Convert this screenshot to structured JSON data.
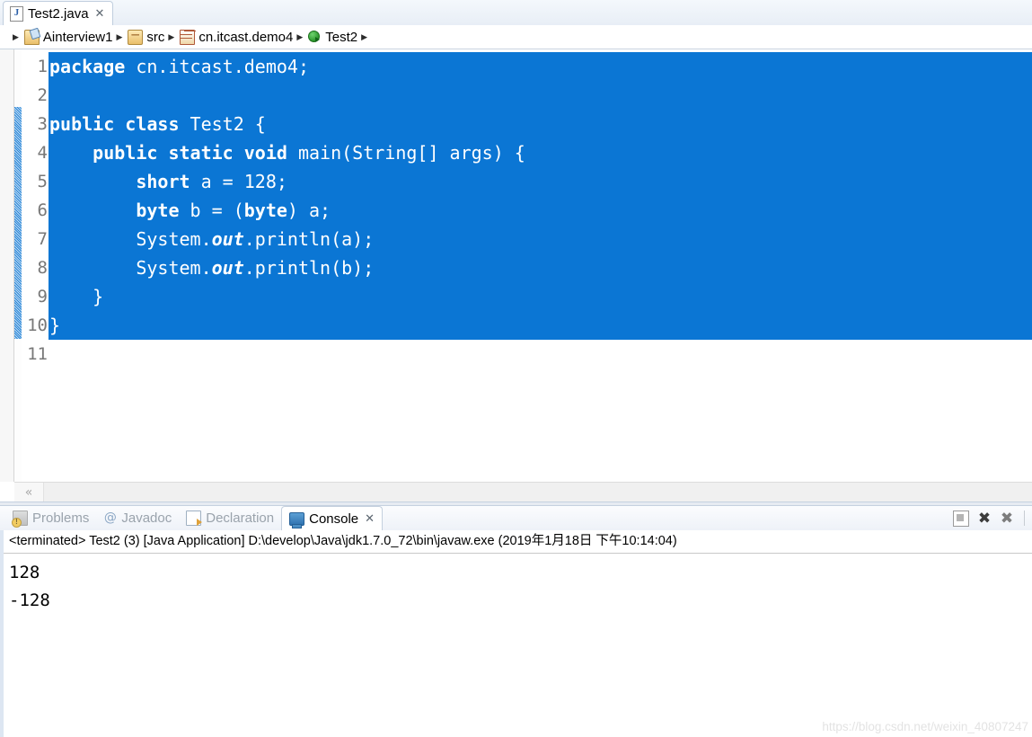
{
  "editor": {
    "tab": {
      "file_icon": "java-file-icon",
      "label": "Test2.java",
      "close": "✕"
    },
    "breadcrumb": {
      "separator": "▶",
      "items": [
        {
          "icon": "project-icon",
          "label": "Ainterview1"
        },
        {
          "icon": "source-folder-icon",
          "label": "src"
        },
        {
          "icon": "package-icon",
          "label": "cn.itcast.demo4"
        },
        {
          "icon": "java-class-icon",
          "label": "Test2"
        }
      ]
    },
    "line_numbers": [
      "1",
      "2",
      "3",
      "4",
      "5",
      "6",
      "7",
      "8",
      "9",
      "10",
      "11"
    ],
    "code_lines": [
      {
        "selected": true,
        "tokens": [
          {
            "t": "kw",
            "v": "package"
          },
          {
            "t": "pl",
            "v": " cn.itcast.demo4;"
          }
        ]
      },
      {
        "selected": true,
        "tokens": [
          {
            "t": "pl",
            "v": ""
          }
        ]
      },
      {
        "selected": true,
        "tokens": [
          {
            "t": "kw",
            "v": "public class"
          },
          {
            "t": "pl",
            "v": " Test2 {"
          }
        ]
      },
      {
        "selected": true,
        "tokens": [
          {
            "t": "pl",
            "v": "    "
          },
          {
            "t": "kw",
            "v": "public static void"
          },
          {
            "t": "pl",
            "v": " main(String[] args) {"
          }
        ]
      },
      {
        "selected": true,
        "tokens": [
          {
            "t": "pl",
            "v": "        "
          },
          {
            "t": "kw",
            "v": "short"
          },
          {
            "t": "pl",
            "v": " a = 128;"
          }
        ]
      },
      {
        "selected": true,
        "tokens": [
          {
            "t": "pl",
            "v": "        "
          },
          {
            "t": "kw",
            "v": "byte"
          },
          {
            "t": "pl",
            "v": " b = ("
          },
          {
            "t": "kw",
            "v": "byte"
          },
          {
            "t": "pl",
            "v": ") a;"
          }
        ]
      },
      {
        "selected": true,
        "tokens": [
          {
            "t": "pl",
            "v": "        System."
          },
          {
            "t": "fld",
            "v": "out"
          },
          {
            "t": "pl",
            "v": ".println(a);"
          }
        ]
      },
      {
        "selected": true,
        "tokens": [
          {
            "t": "pl",
            "v": "        System."
          },
          {
            "t": "fld",
            "v": "out"
          },
          {
            "t": "pl",
            "v": ".println(b);"
          }
        ]
      },
      {
        "selected": true,
        "tokens": [
          {
            "t": "pl",
            "v": "    }"
          }
        ]
      },
      {
        "selected": true,
        "tokens": [
          {
            "t": "pl",
            "v": "}"
          }
        ]
      },
      {
        "selected": false,
        "tokens": [
          {
            "t": "pl",
            "v": ""
          }
        ]
      }
    ],
    "hscroll_left_glyph": "«"
  },
  "console_view": {
    "tabs": [
      {
        "icon": "problems-icon",
        "label": "Problems",
        "active": false
      },
      {
        "icon": "javadoc-icon",
        "label": "Javadoc",
        "active": false
      },
      {
        "icon": "declaration-icon",
        "label": "Declaration",
        "active": false
      },
      {
        "icon": "console-icon",
        "label": "Console",
        "active": true,
        "close": "✕"
      }
    ],
    "toolbar": [
      {
        "name": "terminate-icon",
        "glyph": ""
      },
      {
        "name": "remove-launch-icon",
        "glyph": "✖"
      },
      {
        "name": "remove-all-terminated-icon",
        "glyph": "✖"
      }
    ],
    "header_line": "<terminated> Test2 (3) [Java Application] D:\\develop\\Java\\jdk1.7.0_72\\bin\\javaw.exe (2019年1月18日 下午10:14:04)",
    "output_lines": [
      "128",
      "-128"
    ]
  },
  "watermark": "https://blog.csdn.net/weixin_40807247",
  "colors": {
    "selection_blue": "#0b76d4",
    "keyword_purple": "#7f0055",
    "field_blue": "#0000c0",
    "fold_marker": "#2986d8"
  }
}
